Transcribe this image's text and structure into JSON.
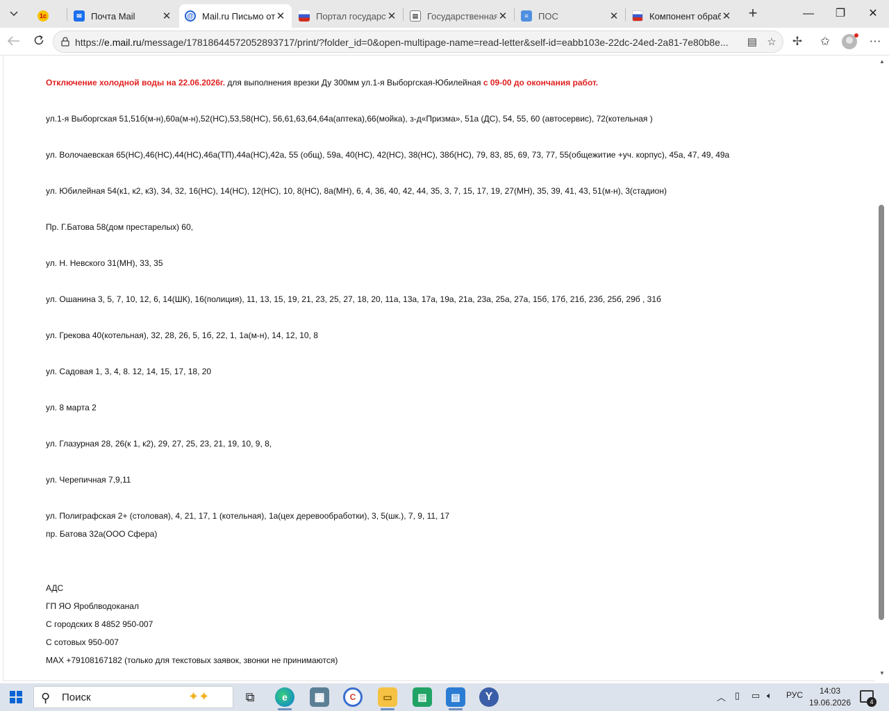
{
  "browser": {
    "tabs": [
      {
        "title": "",
        "icon": "1c-icon",
        "color": "#f7c200"
      },
      {
        "title": "Почта Mail",
        "icon": "mail-icon",
        "color": "#1a6ff0"
      },
      {
        "title": "Mail.ru Письмо от к",
        "icon": "mailru-icon",
        "color": "#1f5ed6"
      },
      {
        "title": "Портал государств",
        "icon": "flag-icon",
        "color": "#d6d6e6"
      },
      {
        "title": "Государственная и",
        "icon": "document-icon",
        "color": "#8a8a9a"
      },
      {
        "title": "ПОС",
        "icon": "pos-icon",
        "color": "#4e8fe0"
      },
      {
        "title": "Компонент обрабо",
        "icon": "flag-icon",
        "color": "#d6d6e6"
      }
    ],
    "url_prefix": "https://",
    "url_host": "e.mail.ru",
    "url_path": "/message/17818644572052893717/print/?folder_id=0&open-multipage-name=read-letter&self-id=eabb103e-22dc-24ed-2a81-7e80b8e..."
  },
  "letter": {
    "headline_part1": "Отключение холодной воды на 22.06.2026г.",
    "headline_part2": " для выполнения врезки Ду 300мм ул.1-я Выборгская-Юбилейная ",
    "headline_part3": "с 09-00 до окончания работ.",
    "lines": [
      "ул.1-я Выборгская 51,51б(м-н),60а(м-н),52(НС),53,58(НС), 56,61,63,64,64а(аптека),66(мойка), з-д«Призма», 51а (ДС), 54, 55, 60 (автосервис), 72(котельная )",
      "ул. Волочаевская 65(НС),46(НС),44(НС),46а(ТП),44а(НС),42а, 55 (общ), 59а, 40(НС), 42(НС), 38(НС), 38б(НС), 79, 83, 85, 69, 73, 77, 55(общежитие +уч. корпус), 45а, 47, 49, 49а",
      "ул. Юбилейная 54(к1, к2, к3), 34, 32, 16(НС), 14(НС), 12(НС), 10, 8(НС), 8а(МН), 6, 4, 36, 40, 42, 44, 35, 3, 7, 15, 17, 19, 27(МН), 35, 39, 41, 43, 51(м-н), 3(стадион)",
      "Пр. Г.Батова 58(дом престарелых) 60,",
      "ул. Н. Невского 31(МН), 33, 35",
      "ул. Ошанина 3, 5, 7, 10, 12, 6, 14(ШК), 16(полиция), 11, 13, 15, 19, 21, 23, 25, 27, 18, 20, 11а, 13а, 17а, 19а, 21а, 23а, 25а, 27а, 15б, 17б, 21б, 23б, 25б, 29б , 31б",
      "ул. Грекова 40(котельная), 32, 28, 26, 5, 1б, 22, 1, 1а(м-н), 14, 12, 10, 8",
      "ул. Садовая 1, 3, 4, 8. 12, 14, 15, 17, 18, 20",
      "ул. 8 марта 2",
      "ул. Глазурная  28, 26(к 1, к2), 29, 27, 25, 23, 21, 19, 10, 9, 8,",
      "ул. Черепичная 7,9,11",
      "ул. Полиграфская 2+ (столовая), 4, 21, 17, 1 (котельная), 1а(цех деревообработки), 3, 5(шк.), 7, 9, 11, 17",
      "пр. Батова 32а(ООО Сфера)"
    ],
    "signature": [
      "АДС",
      "ГП ЯО Яроблводоканал",
      "С городских 8 4852 950-007",
      "С сотовых 950-007",
      "MAX +79108167182 (только для текстовых заявок, звонки не принимаются)"
    ]
  },
  "taskbar": {
    "search_placeholder": "Поиск",
    "language": "РУС",
    "time": "14:03",
    "date": "19.06.2026",
    "notifications_count": "4"
  }
}
